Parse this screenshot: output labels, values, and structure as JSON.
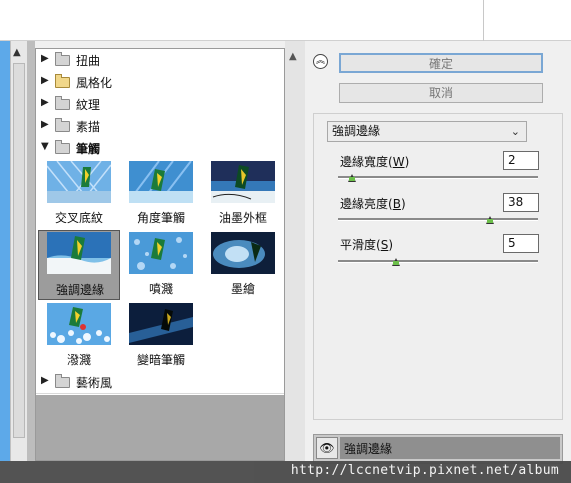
{
  "gallery": {
    "categories": [
      {
        "label": "扭曲",
        "expanded": false
      },
      {
        "label": "風格化",
        "expanded": false
      },
      {
        "label": "紋理",
        "expanded": false
      },
      {
        "label": "素描",
        "expanded": false
      },
      {
        "label": "筆觸",
        "expanded": true
      },
      {
        "label": "藝術風",
        "expanded": false
      }
    ],
    "thumbs": [
      {
        "label": "交叉底紋",
        "icon": "crosshatch-thumbnail"
      },
      {
        "label": "角度筆觸",
        "icon": "angled-strokes-thumbnail"
      },
      {
        "label": "油墨外框",
        "icon": "ink-outlines-thumbnail"
      },
      {
        "label": "強調邊緣",
        "icon": "accented-edges-thumbnail",
        "selected": true
      },
      {
        "label": "噴濺",
        "icon": "spatter-thumbnail"
      },
      {
        "label": "墨繪",
        "icon": "sumi-e-thumbnail"
      },
      {
        "label": "潑濺",
        "icon": "splatter-thumbnail"
      },
      {
        "label": "變暗筆觸",
        "icon": "dark-strokes-thumbnail"
      }
    ]
  },
  "buttons": {
    "ok": "確定",
    "cancel": "取消",
    "collapse_icon": "double-chevron-up-icon"
  },
  "settings": {
    "filter": "強調邊緣",
    "params": [
      {
        "label": "邊緣寬度",
        "key": "W",
        "value": "2",
        "level": 0.07
      },
      {
        "label": "邊緣亮度",
        "key": "B",
        "value": "38",
        "level": 0.76
      },
      {
        "label": "平滑度",
        "key": "S",
        "value": "5",
        "level": 0.29
      }
    ]
  },
  "layers": {
    "items": [
      {
        "label": "強調邊緣",
        "visible": true
      }
    ]
  },
  "watermark": "http://lccnetvip.pixnet.net/album",
  "colors": {
    "accent_border": "#7aa7d4",
    "slider_knob": "#6cbf4a"
  }
}
